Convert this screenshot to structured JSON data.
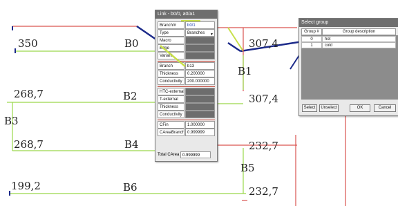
{
  "diagram": {
    "flow_values": [
      "350",
      "268,7",
      "268,7",
      "199,2",
      "307,4",
      "307,4",
      "232,7",
      "232,7"
    ],
    "branches": [
      "B0",
      "B1",
      "B2",
      "B3",
      "B4",
      "B5",
      "B6"
    ]
  },
  "link_dialog": {
    "title": "Link - b0/0, a0/a1",
    "fields": [
      {
        "label": "Branch/#",
        "value": "b0/1"
      },
      {
        "label": "Type",
        "value": "Branches"
      },
      {
        "label": "Macro",
        "value": ""
      },
      {
        "label": "Edge",
        "value": ""
      },
      {
        "label": "Variant",
        "value": ""
      },
      {
        "label": "Branch",
        "value": "b13"
      },
      {
        "label": "Thickness",
        "value": "0.200000"
      },
      {
        "label": "Conductivity",
        "value": "200.000000"
      },
      {
        "label": "HTC-external",
        "value": ""
      },
      {
        "label": "T-external",
        "value": ""
      },
      {
        "label": "Thickness",
        "value": ""
      },
      {
        "label": "Conductivity",
        "value": ""
      },
      {
        "label": "CFin",
        "value": "1.000000"
      },
      {
        "label": "CAreaBranch",
        "value": "0.999999"
      }
    ],
    "total_label": "Total CArea",
    "total_value": "0.999999",
    "type_dropdown_icon": "chevron-down-icon"
  },
  "select_group": {
    "title": "Select group",
    "columns": [
      "Group #",
      "Group description"
    ],
    "rows": [
      {
        "num": "0",
        "desc": "hot"
      },
      {
        "num": "1",
        "desc": "cold"
      }
    ],
    "buttons": [
      "Select",
      "Unselect",
      "OK",
      "Cancel"
    ]
  },
  "colors": {
    "green": "#9ad84a",
    "red": "#d9534f",
    "navy": "#1c2a8a",
    "yellow_green": "#c8e04a",
    "titlebar": "#6e6e6e"
  }
}
